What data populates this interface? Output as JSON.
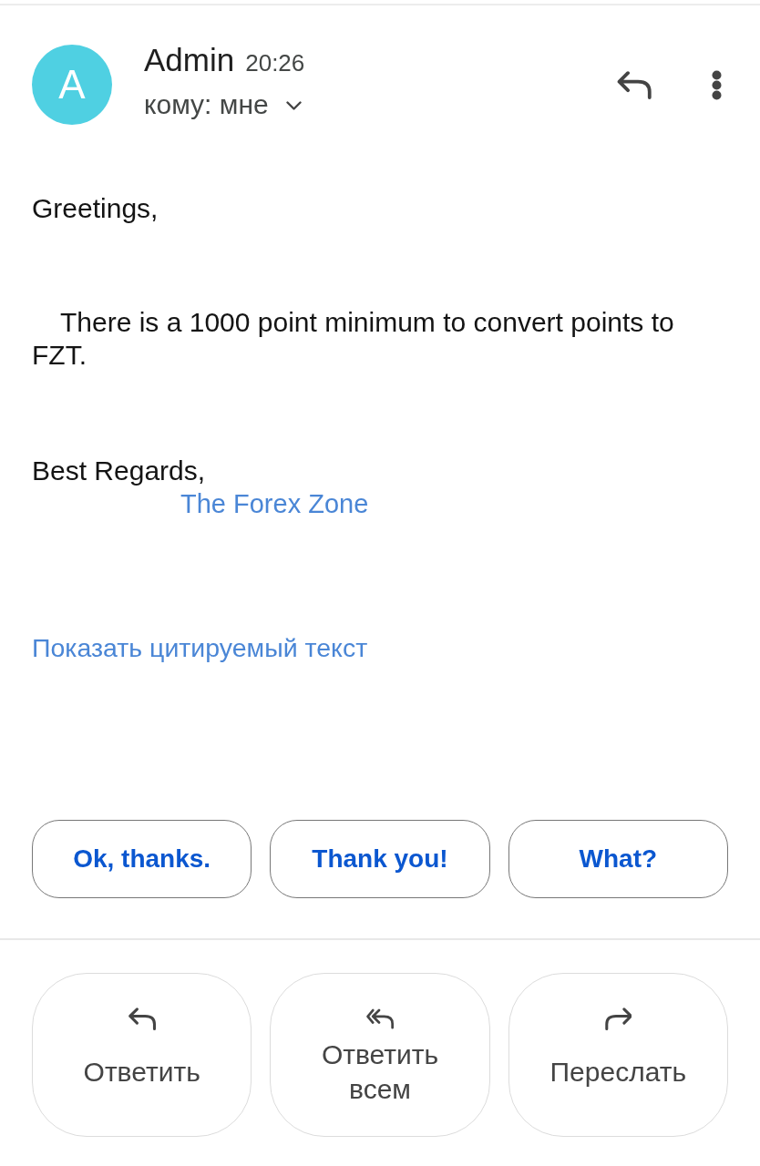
{
  "header": {
    "avatar_letter": "A",
    "sender": "Admin",
    "time": "20:26",
    "recipient": "кому: мне"
  },
  "body": {
    "greeting": "Greetings,",
    "paragraph": "There is a 1000 point minimum to convert points to FZT.",
    "closing": "Best Regards,",
    "signature_link": "The Forex Zone"
  },
  "show_quoted_text": "Показать цитируемый текст",
  "smart_replies": [
    "Ok, thanks.",
    "Thank you!",
    "What?"
  ],
  "actions": [
    {
      "kind": "reply",
      "label": "Ответить"
    },
    {
      "kind": "reply_all",
      "label": "Ответить всем"
    },
    {
      "kind": "forward",
      "label": "Переслать"
    }
  ]
}
